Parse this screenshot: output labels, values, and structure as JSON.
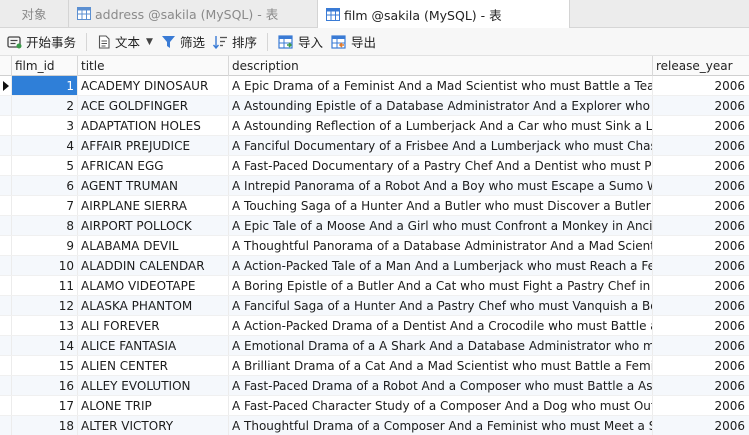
{
  "tabs": [
    {
      "label": "对象"
    },
    {
      "label": "address @sakila (MySQL) - 表"
    },
    {
      "label": "film @sakila (MySQL) - 表",
      "active": true
    }
  ],
  "toolbar": {
    "begin_transaction": "开始事务",
    "text": "文本",
    "filter": "筛选",
    "sort": "排序",
    "import": "导入",
    "export": "导出"
  },
  "columns": [
    "film_id",
    "title",
    "description",
    "release_year"
  ],
  "rows": [
    {
      "film_id": "1",
      "title": "ACADEMY DINOSAUR",
      "description": "A Epic Drama of a Feminist And a Mad Scientist who must Battle a Teacher in Th",
      "release_year": "2006"
    },
    {
      "film_id": "2",
      "title": "ACE GOLDFINGER",
      "description": "A Astounding Epistle of a Database Administrator And a Explorer who must Finc",
      "release_year": "2006"
    },
    {
      "film_id": "3",
      "title": "ADAPTATION HOLES",
      "description": "A Astounding Reflection of a Lumberjack And a Car who must Sink a Lumberjac",
      "release_year": "2006"
    },
    {
      "film_id": "4",
      "title": "AFFAIR PREJUDICE",
      "description": "A Fanciful Documentary of a Frisbee And a Lumberjack who must Chase a Monk",
      "release_year": "2006"
    },
    {
      "film_id": "5",
      "title": "AFRICAN EGG",
      "description": "A Fast-Paced Documentary of a Pastry Chef And a Dentist who must Pursue a Fo",
      "release_year": "2006"
    },
    {
      "film_id": "6",
      "title": "AGENT TRUMAN",
      "description": "A Intrepid Panorama of a Robot And a Boy who must Escape a Sumo Wrestler in",
      "release_year": "2006"
    },
    {
      "film_id": "7",
      "title": "AIRPLANE SIERRA",
      "description": "A Touching Saga of a Hunter And a Butler who must Discover a Butler in A Jet Bo",
      "release_year": "2006"
    },
    {
      "film_id": "8",
      "title": "AIRPORT POLLOCK",
      "description": "A Epic Tale of a Moose And a Girl who must Confront a Monkey in Ancient India",
      "release_year": "2006"
    },
    {
      "film_id": "9",
      "title": "ALABAMA DEVIL",
      "description": "A Thoughtful Panorama of a Database Administrator And a Mad Scientist who n",
      "release_year": "2006"
    },
    {
      "film_id": "10",
      "title": "ALADDIN CALENDAR",
      "description": "A Action-Packed Tale of a Man And a Lumberjack who must Reach a Feminist ir",
      "release_year": "2006"
    },
    {
      "film_id": "11",
      "title": "ALAMO VIDEOTAPE",
      "description": "A Boring Epistle of a Butler And a Cat who must Fight a Pastry Chef in A MySQL",
      "release_year": "2006"
    },
    {
      "film_id": "12",
      "title": "ALASKA PHANTOM",
      "description": "A Fanciful Saga of a Hunter And a Pastry Chef who must Vanquish a Boy in Aust",
      "release_year": "2006"
    },
    {
      "film_id": "13",
      "title": "ALI FOREVER",
      "description": "A Action-Packed Drama of a Dentist And a Crocodile who must Battle a Feminis",
      "release_year": "2006"
    },
    {
      "film_id": "14",
      "title": "ALICE FANTASIA",
      "description": "A Emotional Drama of a A Shark And a Database Administrator who must Vanqu",
      "release_year": "2006"
    },
    {
      "film_id": "15",
      "title": "ALIEN CENTER",
      "description": "A Brilliant Drama of a Cat And a Mad Scientist who must Battle a Feminist in A N",
      "release_year": "2006"
    },
    {
      "film_id": "16",
      "title": "ALLEY EVOLUTION",
      "description": "A Fast-Paced Drama of a Robot And a Composer who must Battle a Astronaut ir",
      "release_year": "2006"
    },
    {
      "film_id": "17",
      "title": "ALONE TRIP",
      "description": "A Fast-Paced Character Study of a Composer And a Dog who must Outgun a Bo",
      "release_year": "2006"
    },
    {
      "film_id": "18",
      "title": "ALTER VICTORY",
      "description": "A Thoughtful Drama of a Composer And a Feminist who must Meet a Secret Ag",
      "release_year": "2006"
    }
  ],
  "selected_row": 0,
  "colors": {
    "selection": "#2f7fd8",
    "icon_blue": "#3a7bd5",
    "icon_green": "#3b9a4a"
  }
}
